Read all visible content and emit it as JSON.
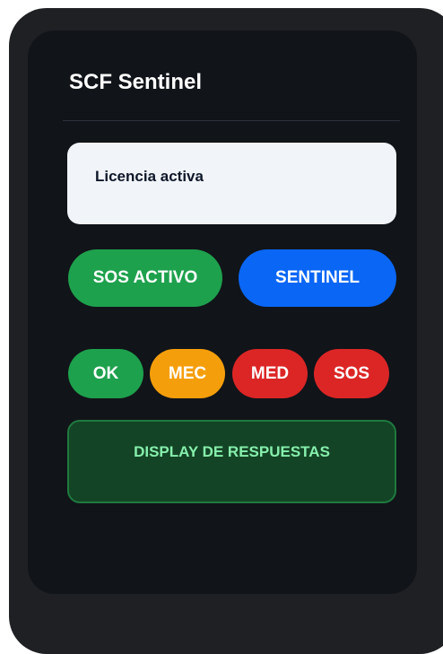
{
  "app": {
    "title": "SCF Sentinel"
  },
  "license": {
    "status_text": "Licencia activa"
  },
  "mode_buttons": {
    "sos_active": {
      "label": "SOS ACTIVO",
      "color": "#1ea14d"
    },
    "sentinel": {
      "label": "SENTINEL",
      "color": "#0a66f5"
    }
  },
  "status_buttons": [
    {
      "label": "OK",
      "color": "#1ea14d"
    },
    {
      "label": "MEC",
      "color": "#f59e0b"
    },
    {
      "label": "MED",
      "color": "#dc2626"
    },
    {
      "label": "SOS",
      "color": "#dc2626"
    }
  ],
  "display": {
    "label": "DISPLAY DE RESPUESTAS"
  },
  "colors": {
    "device_frame": "#1e2024",
    "screen_background": "#111419",
    "card_background": "#f1f5f9",
    "display_background": "#134425",
    "display_text": "#86efac"
  }
}
